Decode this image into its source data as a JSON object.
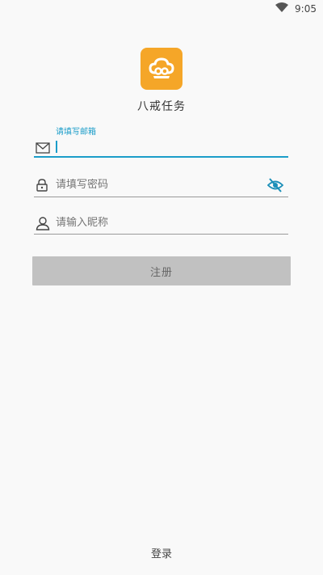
{
  "status_bar": {
    "time": "9:05",
    "wifi_icon": "wifi-icon"
  },
  "app": {
    "name": "八戒任务",
    "icon": "cloud-logo-icon",
    "accent_color": "#f5a628"
  },
  "form": {
    "email": {
      "floating_label": "请填写邮箱",
      "value": "",
      "icon": "mail-icon"
    },
    "password": {
      "placeholder": "请填写密码",
      "value": "",
      "icon": "lock-icon",
      "toggle_icon": "eye-off-icon"
    },
    "nickname": {
      "placeholder": "请输入昵称",
      "value": "",
      "icon": "person-icon"
    }
  },
  "buttons": {
    "register_label": "注册",
    "login_label": "登录"
  },
  "colors": {
    "focus": "#1b9dc9",
    "button_disabled": "#c1c1c1"
  }
}
